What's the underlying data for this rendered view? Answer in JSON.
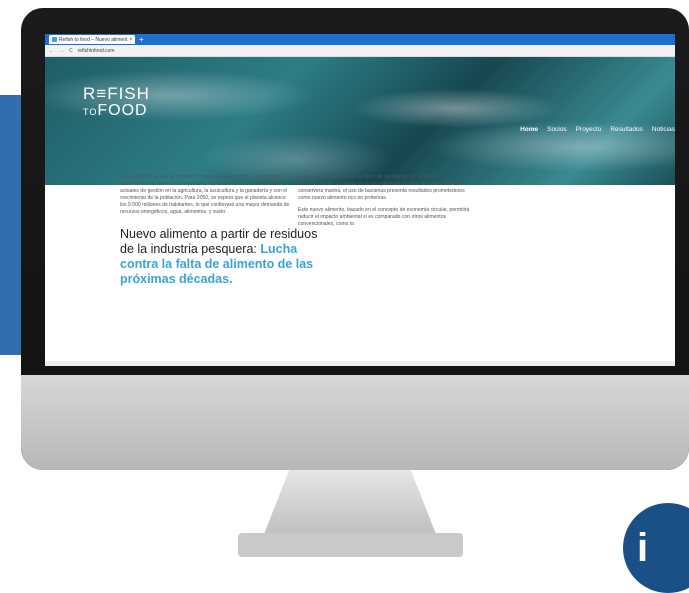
{
  "browser": {
    "tab_title": "Refish to food – Nuevo aliment",
    "tab_close": "×",
    "new_tab": "+",
    "back": "←",
    "forward": "→",
    "reload": "C",
    "url": "refishtofood.com"
  },
  "site": {
    "logo_line1": "R≡FISH",
    "logo_to": "TO",
    "logo_line2": "FOOD",
    "nav": [
      "Home",
      "Socios",
      "Proyecto",
      "Resultados",
      "Noticias"
    ],
    "headline_plain": "Nuevo alimento a partir de residuos de la industria pesquera: ",
    "headline_emphasis": "Lucha contra la falta de alimento de las próximas décadas.",
    "col_left": "En el contexto actual de consumo, mantener la demanda y la seguridad alimentaria será bastante complicado, especialmente con los modelos actuales de gestión en la agricultura, la acuicultura y la ganadería y con el crecimiento de la población. Para 2050, se espera que el planeta alcance los 9.500 millones de habitantes, lo que conllevará una mayor demanda de recursos energéticos, agua, alimentos, y suelo.",
    "col_right_p1": "proteínas que sirva como sustituto de las fuentes de alimento convencionales. Centrado en la recuperación de efluentes de la industria conservera marina, el uso de bacterias presenta resultados prometedores como nuevo alimento rico en proteínas.",
    "col_right_p2": "Este nuevo alimento, basado en el concepto de economía circular, permitirá reducir el impacto ambiental si es comparado con otros alimentos convencionales, como la"
  },
  "badge": {
    "text": "i"
  },
  "colors": {
    "accent": "#3aa3d9",
    "tabbar": "#1f6fd0",
    "side_panel": "#2f6fae"
  }
}
